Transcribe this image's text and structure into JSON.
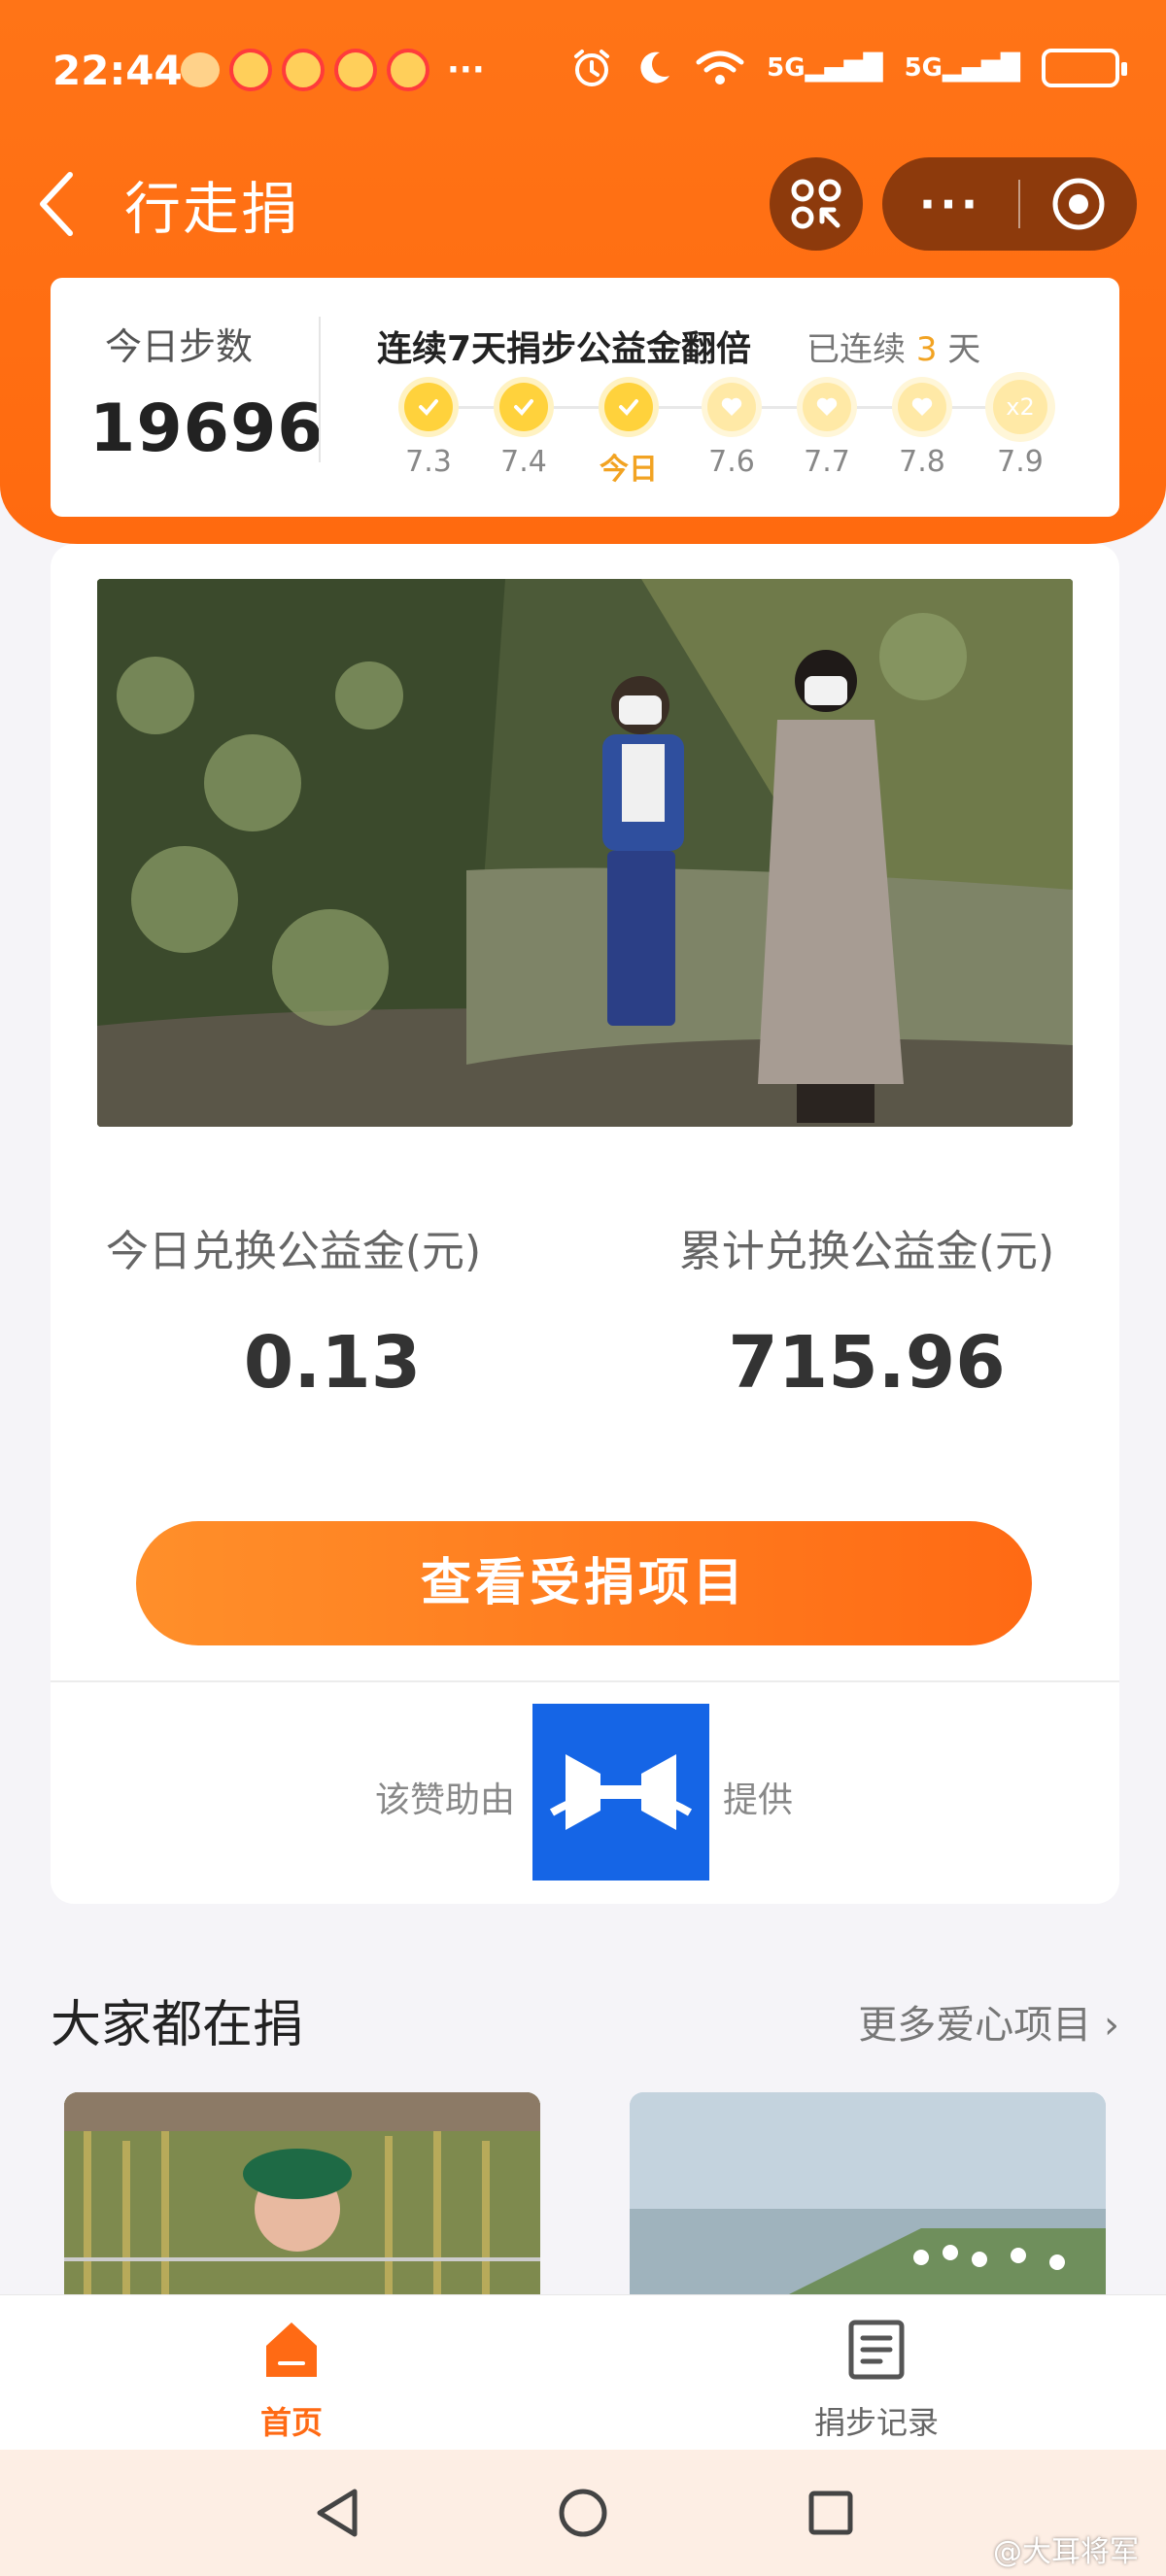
{
  "status_bar": {
    "time": "22:44",
    "more": "···",
    "signal_1": "5G",
    "signal_2": "5G"
  },
  "title_bar": {
    "back": "‹",
    "title": "行走捐",
    "more": "···"
  },
  "steps": {
    "label": "今日步数",
    "value": "19696"
  },
  "streak": {
    "title": "连续7天捐步公益金翻倍",
    "status_prefix": "已连续",
    "days": "3",
    "status_suffix": "天",
    "nodes": [
      {
        "label": "7.3",
        "state": "done"
      },
      {
        "label": "7.4",
        "state": "done"
      },
      {
        "label": "今日",
        "state": "done"
      },
      {
        "label": "7.6",
        "state": "todo"
      },
      {
        "label": "7.7",
        "state": "todo"
      },
      {
        "label": "7.8",
        "state": "todo"
      },
      {
        "label": "7.9",
        "state": "x2",
        "badge": "x2"
      }
    ]
  },
  "donation": {
    "today_label": "今日兑换公益金(元)",
    "today_value": "0.13",
    "total_label": "累计兑换公益金(元)",
    "total_value": "715.96",
    "cta": "查看受捐项目",
    "sponsor_prefix": "该赞助由",
    "sponsor_suffix": "提供"
  },
  "section": {
    "title": "大家都在捐",
    "more": "更多爱心项目 ›"
  },
  "tabs": [
    {
      "label": "首页",
      "icon": "home-icon",
      "active": true
    },
    {
      "label": "捐步记录",
      "icon": "record-icon",
      "active": false
    }
  ],
  "watermark": "@大耳将军",
  "colors": {
    "brand_orange": "#ff6a14",
    "streak_gold": "#f2a322",
    "sponsor_blue": "#1565e6"
  }
}
